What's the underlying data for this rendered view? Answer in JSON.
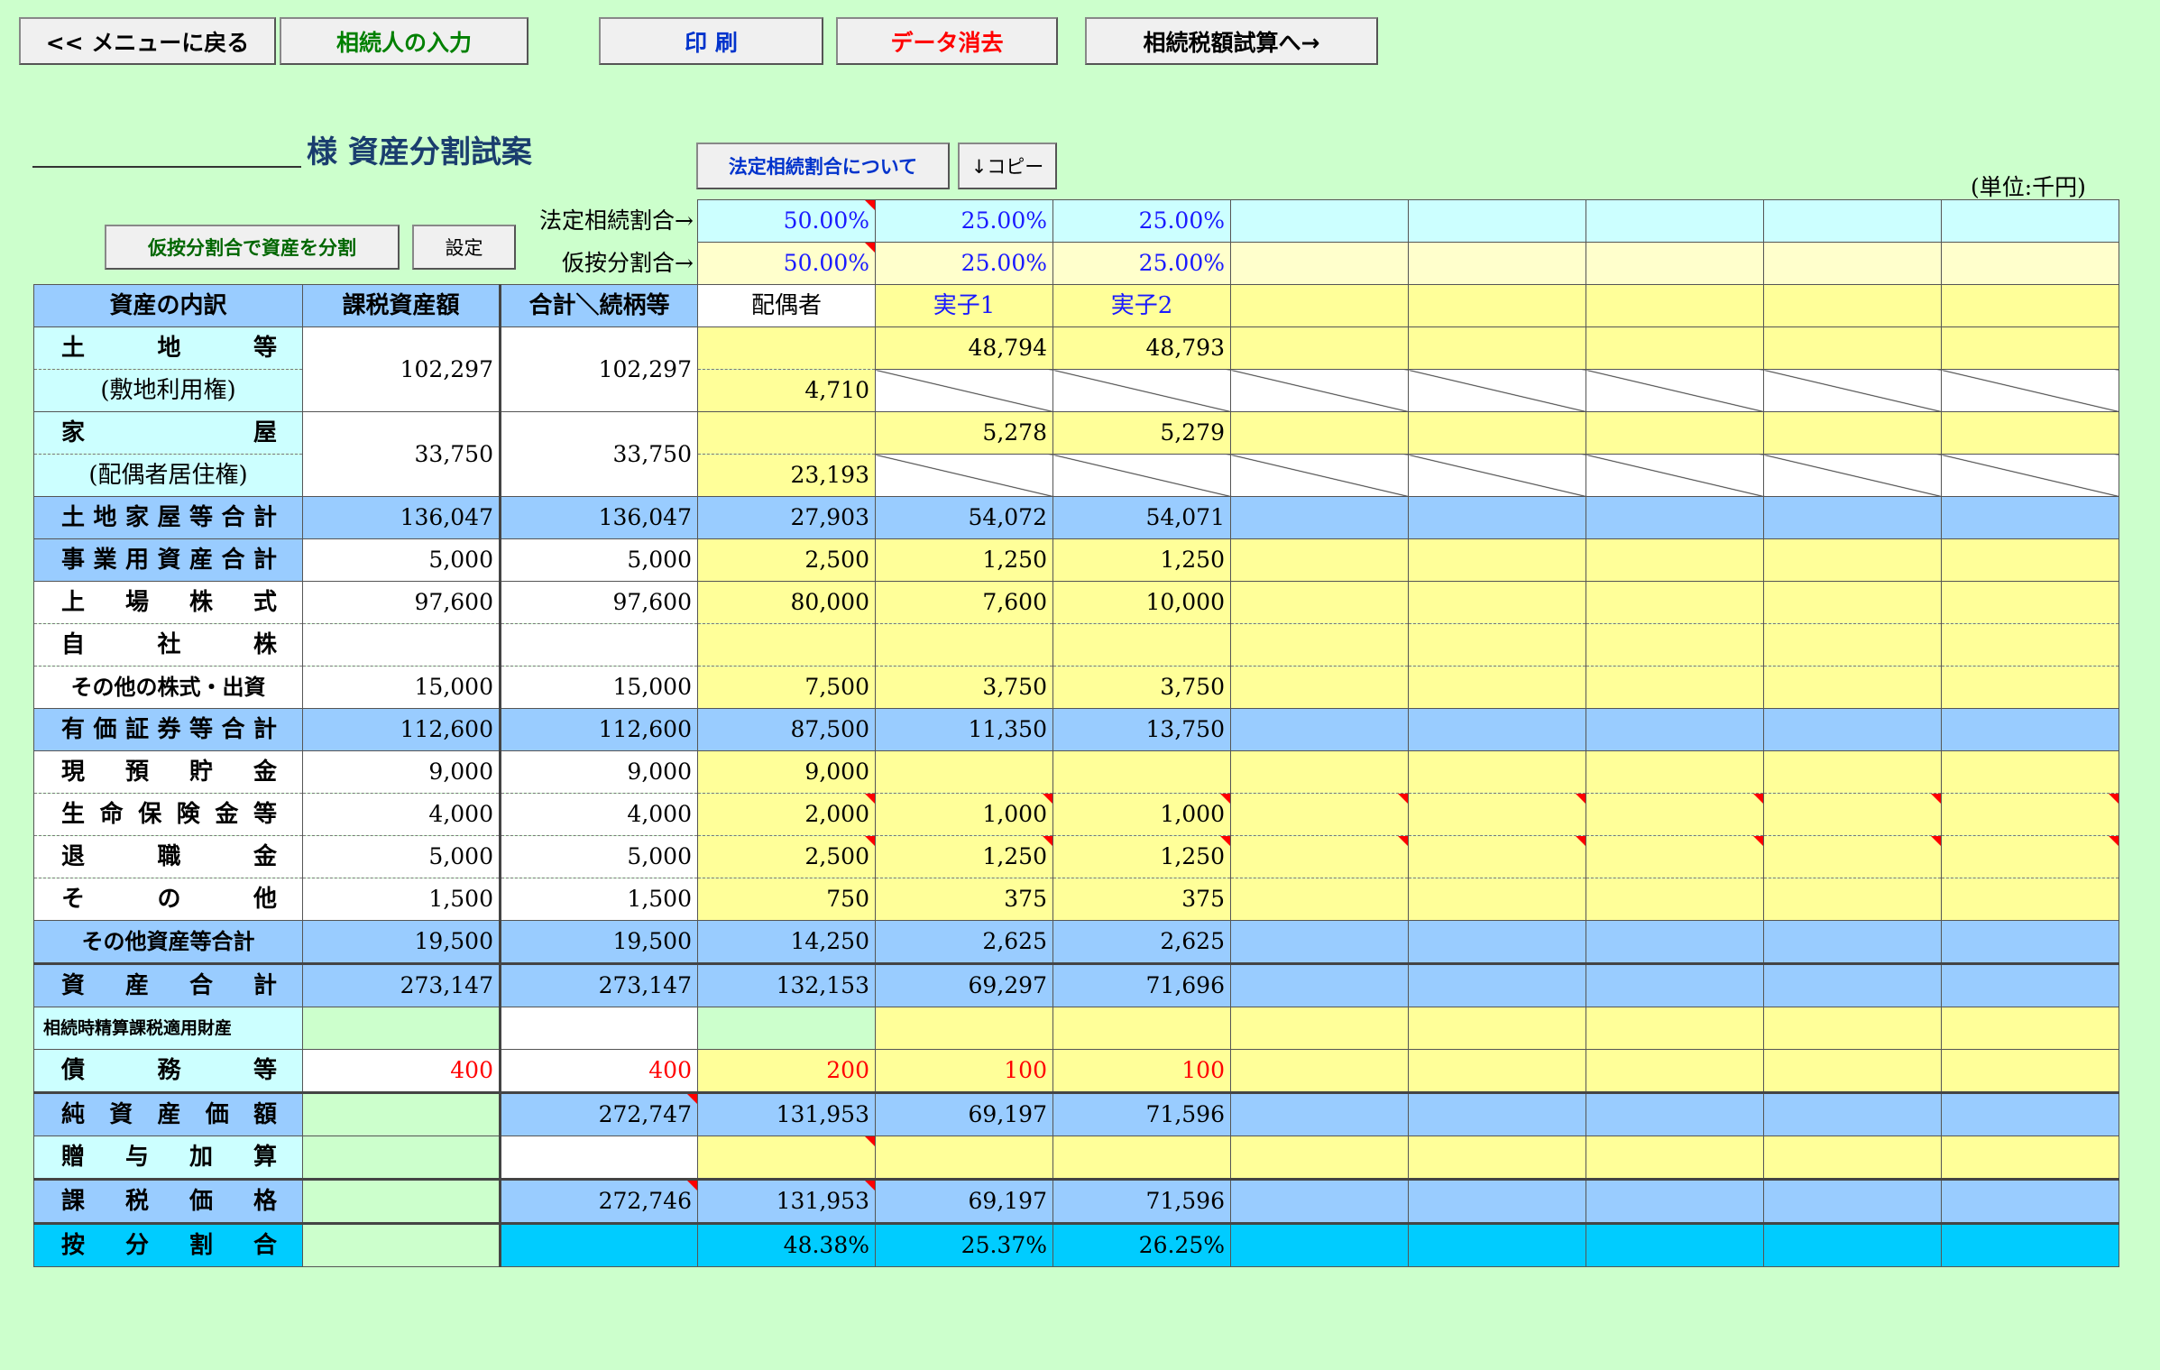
{
  "toolbar": {
    "back": "<< メニューに戻る",
    "heirs": "相続人の入力",
    "print": "印 刷",
    "clear": "データ消去",
    "tax": "相続税額試算へ→",
    "legal_about": "法定相続割合について",
    "copy": "↓コピー",
    "split": "仮按分割合で資産を分割",
    "set": "設定"
  },
  "colors": {
    "heirs": "#008000",
    "print": "#0033cc",
    "clear": "#ff0000",
    "legal_about": "#0033cc",
    "split": "#006600"
  },
  "title": "様 資産分割試案",
  "unit": "(単位:千円)",
  "labels": {
    "legal_ratio": "法定相続割合→",
    "prov_ratio": "仮按分割合→"
  },
  "ratios": {
    "legal": [
      "50.00%",
      "25.00%",
      "25.00%"
    ],
    "prov": [
      "50.00%",
      "25.00%",
      "25.00%"
    ]
  },
  "header": {
    "item": "資産の内訳",
    "taxable": "課税資産額",
    "total": "合計＼続柄等",
    "heirs": [
      "配偶者",
      "実子1",
      "実子2"
    ]
  },
  "rows": [
    {
      "label": "土地等",
      "taxable": "102,297",
      "total": "102,297",
      "h": [
        "",
        "48,794",
        "48,793"
      ]
    },
    {
      "label": "(敷地利用権)",
      "h": [
        "4,710"
      ]
    },
    {
      "label": "家屋",
      "taxable": "33,750",
      "total": "33,750",
      "h": [
        "",
        "5,278",
        "5,279"
      ]
    },
    {
      "label": "(配偶者居住権)",
      "h": [
        "23,193"
      ]
    },
    {
      "label": "土地家屋等合計",
      "taxable": "136,047",
      "total": "136,047",
      "h": [
        "27,903",
        "54,072",
        "54,071"
      ]
    },
    {
      "label": "事業用資産合計",
      "taxable": "5,000",
      "total": "5,000",
      "h": [
        "2,500",
        "1,250",
        "1,250"
      ]
    },
    {
      "label": "上場株式",
      "taxable": "97,600",
      "total": "97,600",
      "h": [
        "80,000",
        "7,600",
        "10,000"
      ]
    },
    {
      "label": "自社株",
      "taxable": "",
      "total": "",
      "h": [
        "",
        "",
        ""
      ]
    },
    {
      "label": "その他の株式・出資",
      "taxable": "15,000",
      "total": "15,000",
      "h": [
        "7,500",
        "3,750",
        "3,750"
      ]
    },
    {
      "label": "有価証券等合計",
      "taxable": "112,600",
      "total": "112,600",
      "h": [
        "87,500",
        "11,350",
        "13,750"
      ]
    },
    {
      "label": "現預貯金",
      "taxable": "9,000",
      "total": "9,000",
      "h": [
        "9,000",
        "",
        ""
      ]
    },
    {
      "label": "生命保険金等",
      "taxable": "4,000",
      "total": "4,000",
      "h": [
        "2,000",
        "1,000",
        "1,000"
      ]
    },
    {
      "label": "退職金",
      "taxable": "5,000",
      "total": "5,000",
      "h": [
        "2,500",
        "1,250",
        "1,250"
      ]
    },
    {
      "label": "その他",
      "taxable": "1,500",
      "total": "1,500",
      "h": [
        "750",
        "375",
        "375"
      ]
    },
    {
      "label": "その他資産等合計",
      "taxable": "19,500",
      "total": "19,500",
      "h": [
        "14,250",
        "2,625",
        "2,625"
      ]
    },
    {
      "label": "資産合計",
      "taxable": "273,147",
      "total": "273,147",
      "h": [
        "132,153",
        "69,297",
        "71,696"
      ]
    },
    {
      "label": "相続時精算課税適用財産",
      "taxable": "",
      "total": "",
      "h": [
        "",
        "",
        ""
      ]
    },
    {
      "label": "債務等",
      "taxable": "400",
      "total": "400",
      "h": [
        "200",
        "100",
        "100"
      ]
    },
    {
      "label": "純資産価額",
      "taxable": "",
      "total": "272,747",
      "h": [
        "131,953",
        "69,197",
        "71,596"
      ]
    },
    {
      "label": "贈与加算",
      "taxable": "",
      "total": "",
      "h": [
        "",
        "",
        ""
      ]
    },
    {
      "label": "課税価格",
      "taxable": "",
      "total": "272,746",
      "h": [
        "131,953",
        "69,197",
        "71,596"
      ]
    },
    {
      "label": "按分割合",
      "taxable": "",
      "total": "",
      "h": [
        "48.38%",
        "25.37%",
        "26.25%"
      ]
    }
  ]
}
